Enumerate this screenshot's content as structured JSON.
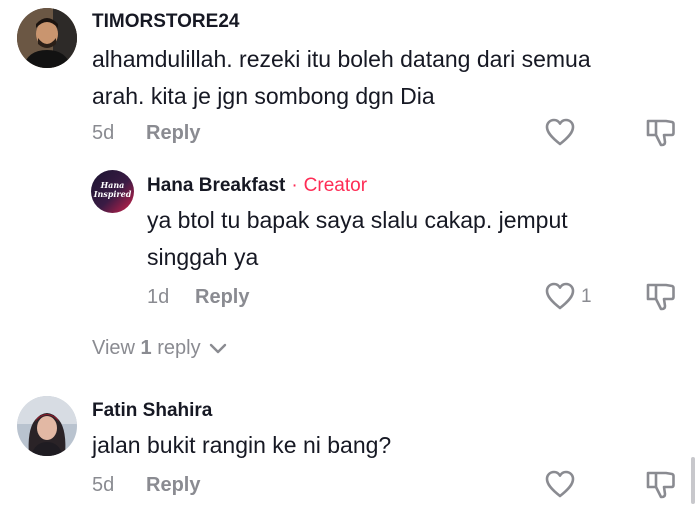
{
  "comments": [
    {
      "username": "TIMORSTORE24",
      "text_line1": "alhamdulillah. rezeki itu boleh datang dari semua",
      "text_line2": "arah. kita je jgn sombong dgn Dia",
      "time": "5d",
      "reply_label": "Reply",
      "avatar": "man-portrait"
    },
    {
      "username": "Hana Breakfast",
      "badge": "Creator",
      "badge_sep": "·",
      "text_line1": "ya btol tu bapak saya slalu cakap. jemput",
      "text_line2": "singgah ya",
      "time": "1d",
      "reply_label": "Reply",
      "likes": "1",
      "avatar_text_1": "Hana",
      "avatar_text_2": "Inspired"
    },
    {
      "username": "Fatin Shahira",
      "text_line1": "jalan bukit rangin ke ni bang?",
      "time": "5d",
      "reply_label": "Reply",
      "avatar": "woman-portrait"
    }
  ],
  "view_replies": {
    "prefix": "View ",
    "count": "1",
    "suffix": " reply"
  },
  "icons": {
    "like": "heart-outline-icon",
    "dislike": "thumbs-down-outline-icon",
    "expand": "chevron-down-icon"
  },
  "colors": {
    "creator": "#fe2c55",
    "muted": "#8a8b91",
    "text": "#161823"
  }
}
